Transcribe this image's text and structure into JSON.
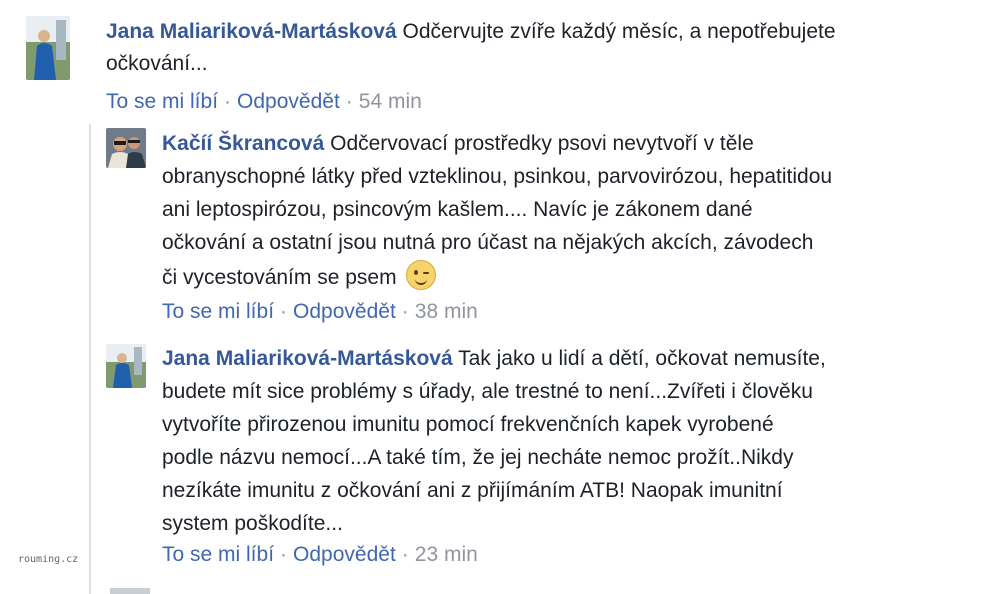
{
  "comments": [
    {
      "author": "Jana Maliariková-Martásková",
      "lines": [
        "Odčervujte zvíře každý měsíc, a nepotřebujete",
        "očkování..."
      ],
      "like_label": "To se mi líbí",
      "reply_label": "Odpovědět",
      "time": "54 min"
    },
    {
      "author": "Kačíí Škrancová",
      "lines": [
        "Odčervovací prostředky psovi nevytvoří v těle",
        "obranyschopné látky před vzteklinou, psinkou, parvovirózou, hepatitidou",
        "ani leptospirózou, psincovým kašlem.... Navíc je zákonem dané",
        "očkování a ostatní jsou nutná pro účast na nějakých akcích, závodech",
        "či vycestováním se psem"
      ],
      "emoji": "wink-emoji",
      "like_label": "To se mi líbí",
      "reply_label": "Odpovědět",
      "time": "38 min"
    },
    {
      "author": "Jana Maliariková-Martásková",
      "lines": [
        "Tak jako u lidí a dětí, očkovat nemusíte,",
        "budete mít sice problémy s úřady, ale trestné to není...Zvířeti i člověku",
        "vytvoříte přirozenou imunitu pomocí frekvenčních kapek vyrobené",
        "podle názvu nemocí...A také tím, že jej necháte nemoc prožít..Nikdy",
        "nezíkáte imunitu z očkování ani z přijímáním ATB! Naopak imunitní",
        "system poškodíte..."
      ],
      "like_label": "To se mi líbí",
      "reply_label": "Odpovědět",
      "time": "23 min"
    }
  ],
  "watermark": "rouming.cz",
  "colors": {
    "name": "#365899",
    "link": "#4267b2",
    "meta": "#90949c",
    "text": "#1d2129"
  }
}
